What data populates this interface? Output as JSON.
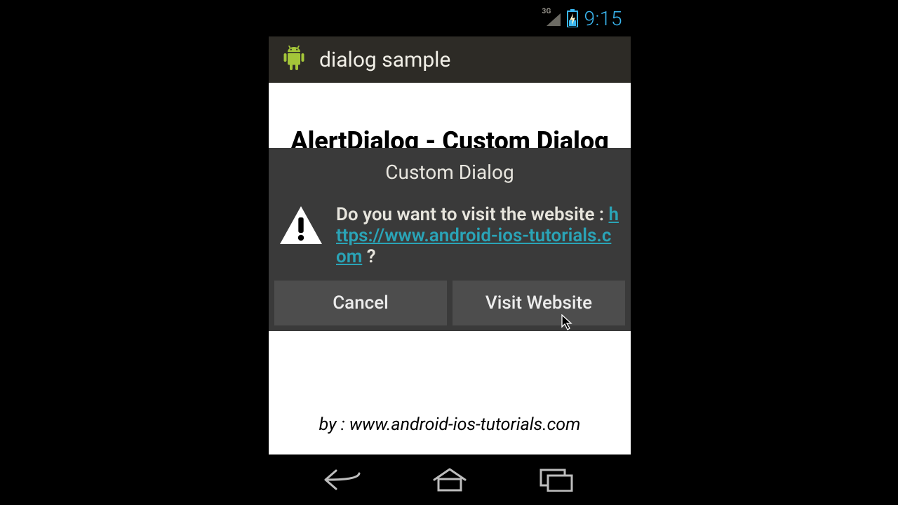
{
  "status": {
    "network_label": "3G",
    "clock": "9:15"
  },
  "action_bar": {
    "title": "dialog sample"
  },
  "background": {
    "heading": "AlertDialog - Custom Dialog",
    "footer": "by : www.android-ios-tutorials.com"
  },
  "dialog": {
    "title": "Custom Dialog",
    "message_prefix": "Do you want to visit the website : ",
    "link_text": "https://www.android-ios-tutorials.com",
    "message_suffix": " ?",
    "cancel_label": "Cancel",
    "confirm_label": "Visit Website"
  }
}
